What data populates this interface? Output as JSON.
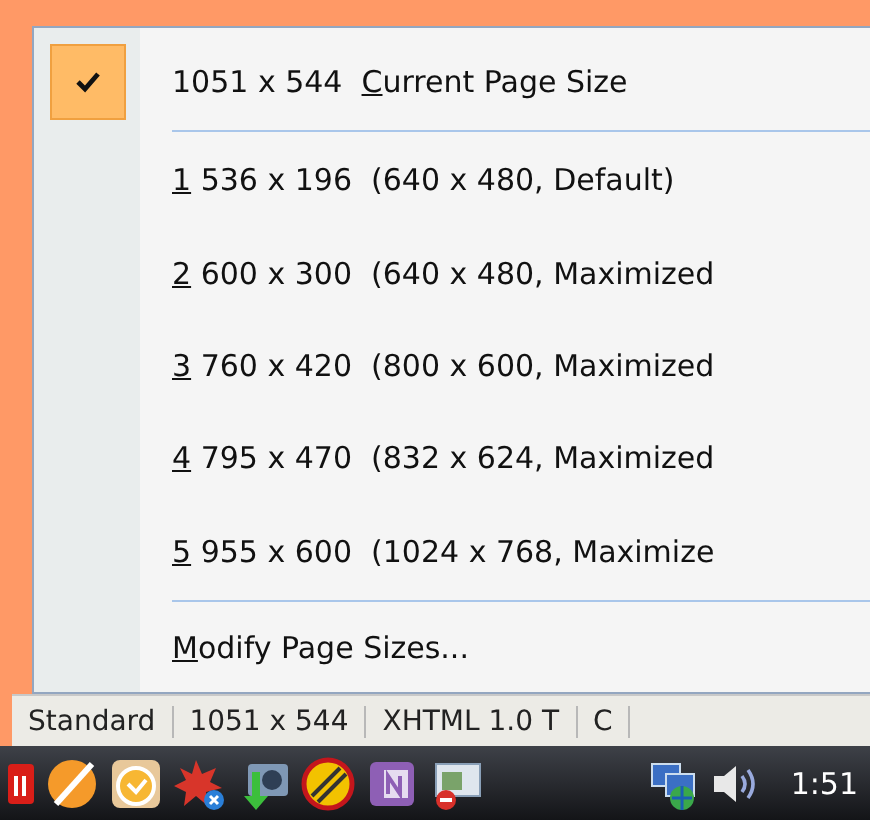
{
  "menu": {
    "items": [
      {
        "kind": "current",
        "checked": true,
        "size": "1051 x 544",
        "mnemonic": "C",
        "text": "urrent Page Size"
      },
      {
        "kind": "preset",
        "checked": false,
        "mnemonic": "1",
        "text": "536 x 196  (640 x 480, Default)"
      },
      {
        "kind": "preset",
        "checked": false,
        "mnemonic": "2",
        "text": "600 x 300  (640 x 480, Maximized"
      },
      {
        "kind": "preset",
        "checked": false,
        "mnemonic": "3",
        "text": "760 x 420  (800 x 600, Maximized"
      },
      {
        "kind": "preset",
        "checked": false,
        "mnemonic": "4",
        "text": "795 x 470  (832 x 624, Maximized"
      },
      {
        "kind": "preset",
        "checked": false,
        "mnemonic": "5",
        "text": "955 x 600  (1024 x 768, Maximize"
      },
      {
        "kind": "command",
        "checked": false,
        "mnemonic": "M",
        "text": "odify Page Sizes..."
      }
    ]
  },
  "status_bar": [
    "Standard",
    "1051 x 544",
    "XHTML 1.0 T",
    "C"
  ],
  "taskbar": {
    "clock": "1:51"
  }
}
